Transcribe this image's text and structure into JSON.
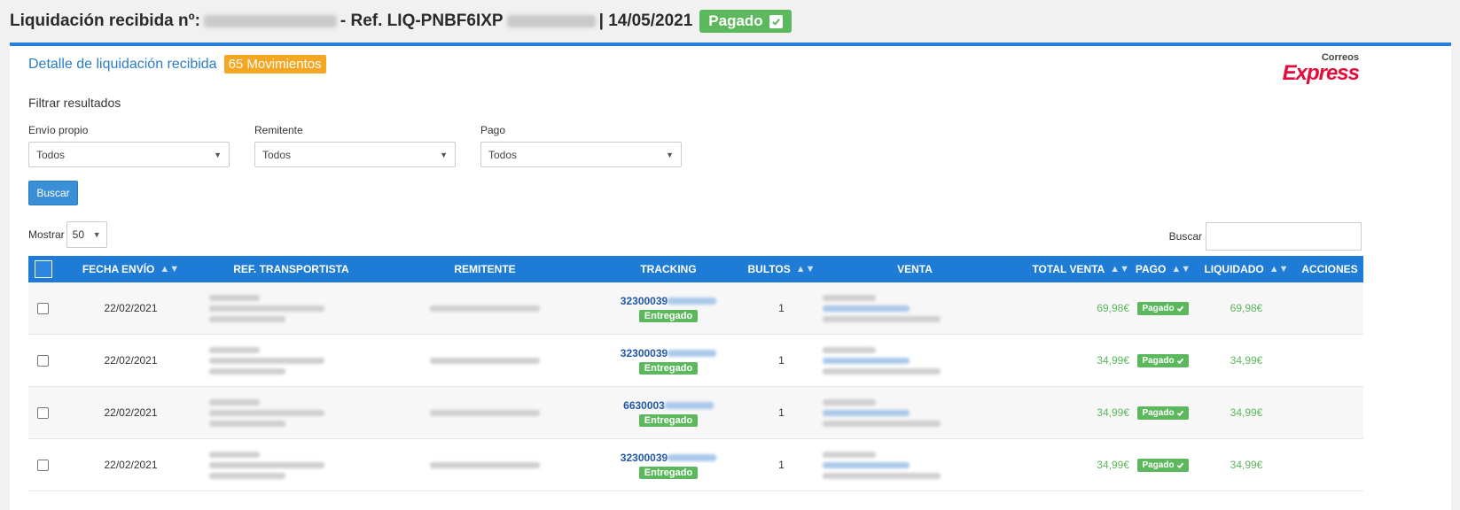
{
  "header": {
    "prefix": "Liquidación recibida nº:",
    "ref_label": "- Ref. LIQ-PNBF6IXP",
    "date": "| 14/05/2021",
    "status": "Pagado"
  },
  "panel": {
    "title": "Detalle de liquidación recibida",
    "movements_badge": "65 Movimientos",
    "logo_small": "Correos",
    "logo_big": "Express"
  },
  "filters": {
    "title": "Filtrar resultados",
    "envio_propio": {
      "label": "Envío propio",
      "value": "Todos"
    },
    "remitente": {
      "label": "Remitente",
      "value": "Todos"
    },
    "pago": {
      "label": "Pago",
      "value": "Todos"
    },
    "search_button": "Buscar"
  },
  "table_controls": {
    "show_label": "Mostrar",
    "show_value": "50",
    "search_label": "Buscar"
  },
  "table": {
    "columns": [
      "FECHA ENVÍO",
      "REF. TRANSPORTISTA",
      "REMITENTE",
      "TRACKING",
      "BULTOS",
      "VENTA",
      "TOTAL VENTA",
      "PAGO",
      "LIQUIDADO",
      "ACCIONES"
    ],
    "rows": [
      {
        "fecha": "22/02/2021",
        "tracking": "32300039",
        "tracking_status": "Entregado",
        "bultos": "1",
        "total": "69,98€",
        "pago": "Pagado",
        "liquidado": "69,98€"
      },
      {
        "fecha": "22/02/2021",
        "tracking": "32300039",
        "tracking_status": "Entregado",
        "bultos": "1",
        "total": "34,99€",
        "pago": "Pagado",
        "liquidado": "34,99€"
      },
      {
        "fecha": "22/02/2021",
        "tracking": "6630003",
        "tracking_status": "Entregado",
        "bultos": "1",
        "total": "34,99€",
        "pago": "Pagado",
        "liquidado": "34,99€"
      },
      {
        "fecha": "22/02/2021",
        "tracking": "32300039",
        "tracking_status": "Entregado",
        "bultos": "1",
        "total": "34,99€",
        "pago": "Pagado",
        "liquidado": "34,99€"
      }
    ]
  }
}
